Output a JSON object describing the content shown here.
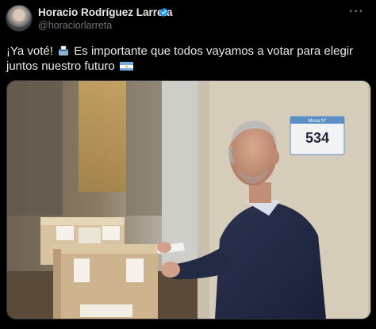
{
  "author": {
    "name": "Horacio Rodríguez Larreta",
    "handle": "@horaciorlarreta",
    "verified_icon": "verified-badge-icon"
  },
  "tweet": {
    "text_part1": "¡Ya voté!",
    "text_part2": "Es importante que todos vayamos a votar para elegir juntos nuestro futuro",
    "emoji_1": "ballot-box-icon",
    "emoji_2": "argentina-flag-icon"
  },
  "photo": {
    "sign_label": "Mesa N°",
    "table_number": "534"
  },
  "menu": {
    "more_label": "···"
  },
  "colors": {
    "background": "#000000",
    "text": "#e7e9ea",
    "muted": "#71767b",
    "verified": "#1d9bf0"
  }
}
